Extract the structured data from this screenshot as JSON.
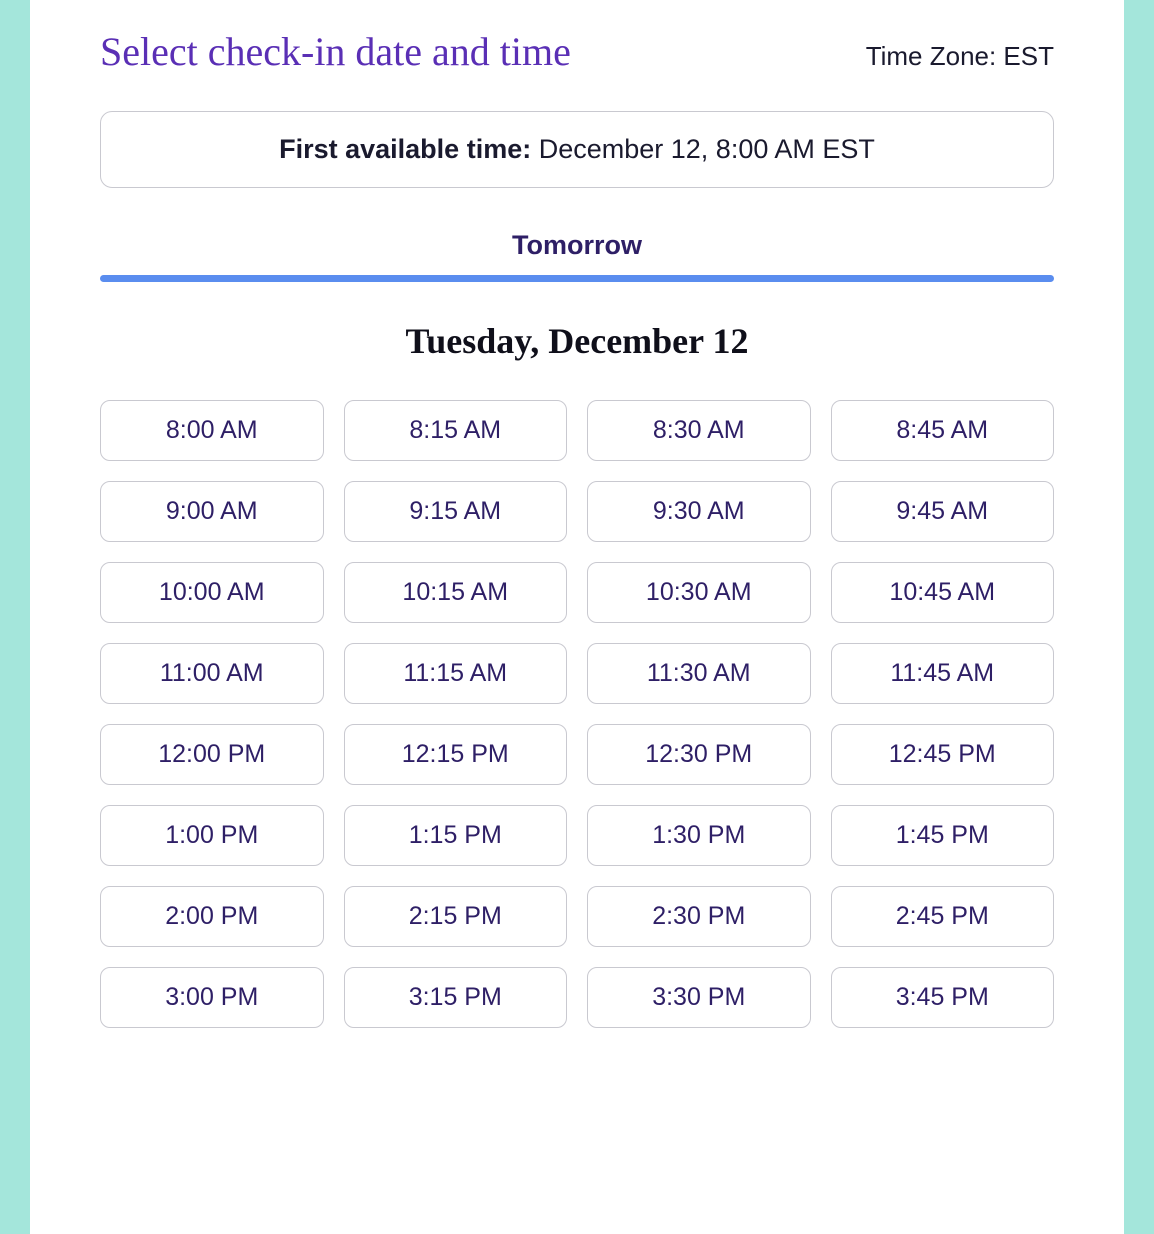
{
  "header": {
    "title": "Select check-in date and time",
    "timezone_label": "Time Zone: EST"
  },
  "first_available": {
    "label": "First available time: ",
    "value": "December 12, 8:00 AM EST"
  },
  "tab": {
    "label": "Tomorrow"
  },
  "date_heading": "Tuesday, December 12",
  "slots": [
    "8:00 AM",
    "8:15 AM",
    "8:30 AM",
    "8:45 AM",
    "9:00 AM",
    "9:15 AM",
    "9:30 AM",
    "9:45 AM",
    "10:00 AM",
    "10:15 AM",
    "10:30 AM",
    "10:45 AM",
    "11:00 AM",
    "11:15 AM",
    "11:30 AM",
    "11:45 AM",
    "12:00 PM",
    "12:15 PM",
    "12:30 PM",
    "12:45 PM",
    "1:00 PM",
    "1:15 PM",
    "1:30 PM",
    "1:45 PM",
    "2:00 PM",
    "2:15 PM",
    "2:30 PM",
    "2:45 PM",
    "3:00 PM",
    "3:15 PM",
    "3:30 PM",
    "3:45 PM"
  ]
}
